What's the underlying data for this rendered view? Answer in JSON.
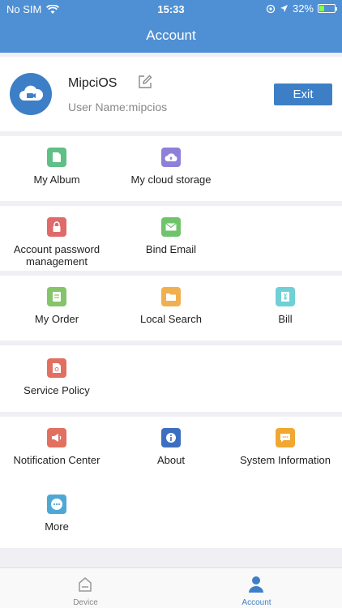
{
  "status_bar": {
    "carrier": "No SIM",
    "time": "15:33",
    "battery": "32%",
    "battery_level": 0.32
  },
  "header": {
    "title": "Account"
  },
  "profile": {
    "name": "MipciOS",
    "username": "User Name:mipcios",
    "exit_label": "Exit"
  },
  "menu": {
    "my_album": "My Album",
    "my_cloud_storage": "My cloud storage",
    "account_password_line1": "Account password",
    "account_password_line2": "management",
    "bind_email": "Bind Email",
    "my_order": "My Order",
    "local_search": "Local Search",
    "bill": "Bill",
    "service_policy": "Service Policy",
    "notification_center": "Notification Center",
    "about": "About",
    "system_information": "System Information",
    "more": "More"
  },
  "tabbar": {
    "device": "Device",
    "account": "Account"
  },
  "colors": {
    "header": "#4f8fd4",
    "accent": "#3d7fc7",
    "album": "#5fbf86",
    "cloud": "#8f7fd9",
    "lock": "#e06a6a",
    "email": "#6fc46b",
    "order": "#86c46b",
    "folder": "#f0b050",
    "bill": "#6fd0d6",
    "policy": "#e27060",
    "notification": "#e27060",
    "about": "#3d6fc0",
    "sysinfo": "#f0a830",
    "more": "#4fa8d4"
  }
}
